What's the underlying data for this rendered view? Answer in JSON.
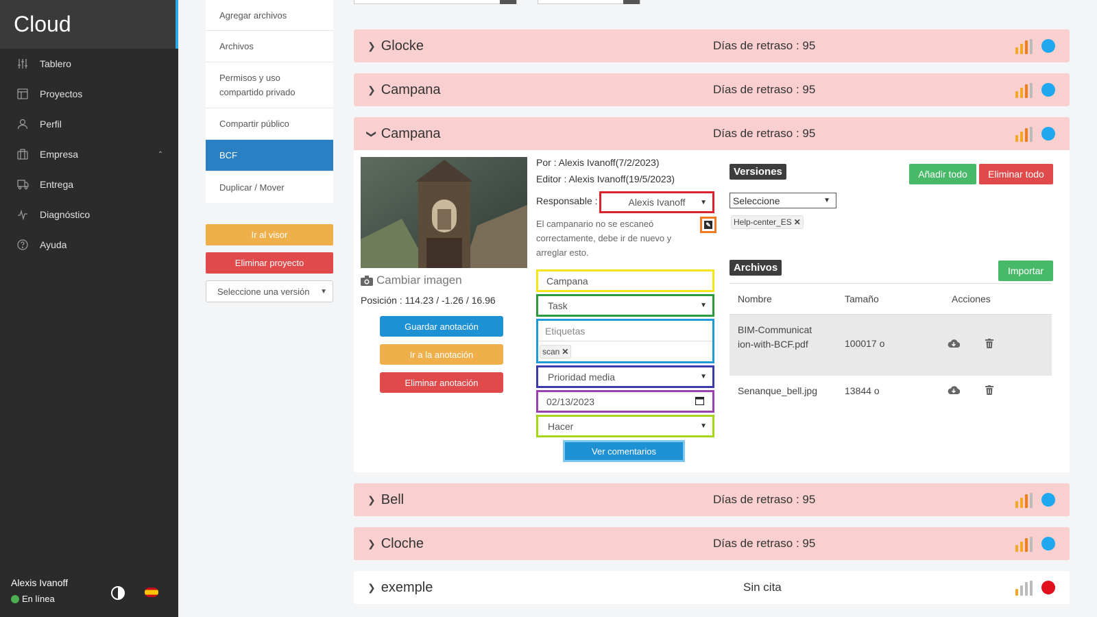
{
  "app": {
    "brand": "Cloud"
  },
  "sidebar": {
    "items": [
      {
        "label": "Tablero",
        "icon": "sliders-icon"
      },
      {
        "label": "Proyectos",
        "icon": "layout-icon"
      },
      {
        "label": "Perfil",
        "icon": "user-icon"
      },
      {
        "label": "Empresa",
        "icon": "building-icon"
      },
      {
        "label": "Entrega",
        "icon": "truck-icon"
      },
      {
        "label": "Diagnóstico",
        "icon": "pulse-icon"
      },
      {
        "label": "Ayuda",
        "icon": "help-icon"
      }
    ],
    "user": {
      "name": "Alexis Ivanoff",
      "status": "En línea"
    }
  },
  "project_menu": {
    "items": [
      "Agregar archivos",
      "Archivos",
      "Permisos y uso compartido privado",
      "Compartir público",
      "BCF",
      "Duplicar / Mover"
    ],
    "active": "BCF",
    "viewer_button": "Ir al visor",
    "delete_button": "Eliminar proyecto",
    "version_select": "Seleccione una versión"
  },
  "issues": [
    {
      "title": "Glocke",
      "delay": "Días de retraso : 95",
      "expanded": false,
      "status_color": "#1fa8f0"
    },
    {
      "title": "Campana",
      "delay": "Días de retraso : 95",
      "expanded": false,
      "status_color": "#1fa8f0"
    },
    {
      "title": "Campana",
      "delay": "Días de retraso : 95",
      "expanded": true,
      "status_color": "#1fa8f0"
    },
    {
      "title": "Bell",
      "delay": "Días de retraso : 95",
      "expanded": false,
      "status_color": "#1fa8f0"
    },
    {
      "title": "Cloche",
      "delay": "Días de retraso : 95",
      "expanded": false,
      "status_color": "#1fa8f0"
    },
    {
      "title": "exemple",
      "delay": "Sin cita",
      "expanded": false,
      "status_color": "#e0101c"
    }
  ],
  "detail": {
    "change_image": "Cambiar imagen",
    "position": "Posición : 114.23 / -1.26 / 16.96",
    "save_annotation": "Guardar anotación",
    "goto_annotation": "Ir a la anotación",
    "delete_annotation": "Eliminar anotación",
    "by": "Por : Alexis Ivanoff(7/2/2023)",
    "editor": "Editor : Alexis Ivanoff(19/5/2023)",
    "responsible_label": "Responsable :",
    "responsible_value": "Alexis Ivanoff",
    "description": "El campanario no se escaneó correctamente, debe ir de nuevo y arreglar esto.",
    "title_value": "Campana",
    "type_value": "Task",
    "tags_placeholder": "Etiquetas",
    "tags": [
      "scan"
    ],
    "priority_value": "Prioridad media",
    "date_value": "02/13/2023",
    "state_value": "Hacer",
    "comments_button": "Ver comentarios"
  },
  "versions": {
    "heading": "Versiones",
    "add_all": "Añadir todo",
    "remove_all": "Eliminar todo",
    "select_value": "Seleccione",
    "chips": [
      "Help-center_ES"
    ]
  },
  "files": {
    "heading": "Archivos",
    "import_button": "Importar",
    "columns": [
      "Nombre",
      "Tamaño",
      "Acciones"
    ],
    "rows": [
      {
        "name": "BIM-Communication-with-BCF.pdf",
        "size": "100017 o"
      },
      {
        "name": "Senanque_bell.jpg",
        "size": "13844 o"
      }
    ]
  },
  "colors": {
    "row_bg": "#f9cfcf",
    "primary": "#1e90d4",
    "warning": "#efb04c",
    "danger": "#e04a4a",
    "success": "#47b968",
    "active_menu": "#2b7fc3"
  }
}
